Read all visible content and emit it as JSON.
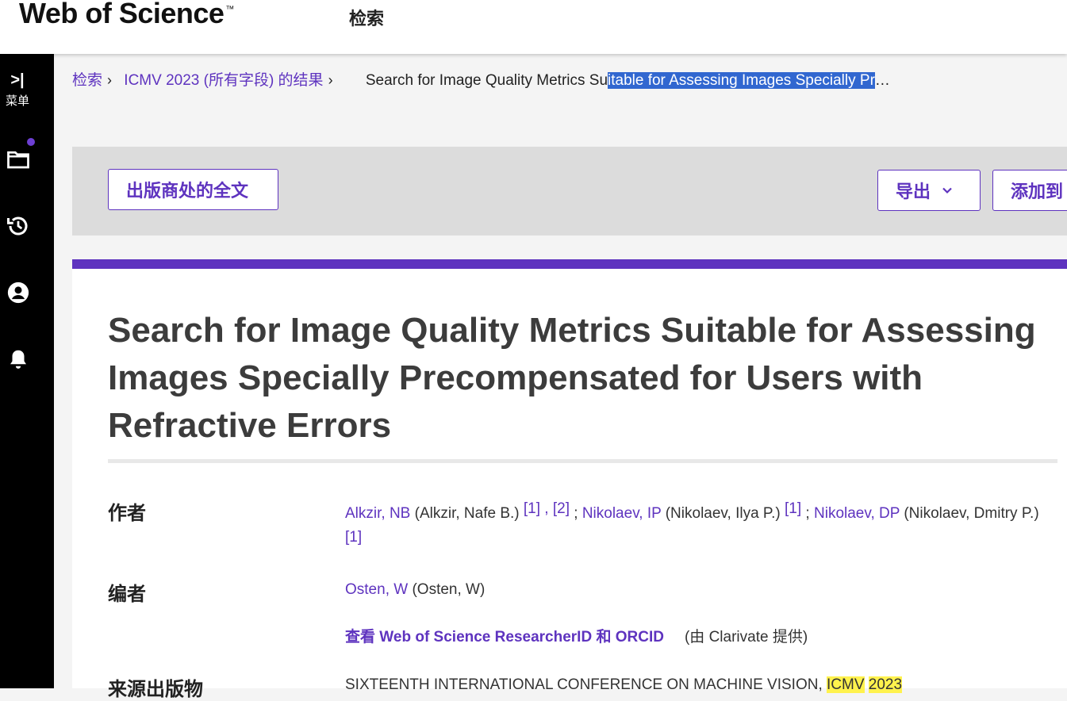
{
  "header": {
    "logo": "Web of Science",
    "logo_tm": "™",
    "nav_search": "检索"
  },
  "sidebar": {
    "menu_chevron": ">|",
    "menu_label": "菜单",
    "icons": [
      "folder-icon",
      "history-icon",
      "user-icon",
      "bell-icon"
    ]
  },
  "breadcrumb": {
    "search": "检索",
    "results": "ICMV 2023 (所有字段) 的结果",
    "current_plain": "Search for Image Quality Metrics Su",
    "current_selected": "itable for Assessing Images Specially Pr",
    "ellipsis": "…"
  },
  "toolbar": {
    "fulltext_label": "出版商处的全文",
    "export_label": "导出",
    "add_label": "添加到"
  },
  "record": {
    "title": "Search for Image Quality Metrics Suitable for Assessing Images Specially Precompensated for Users with Refractive Errors",
    "authors_label": "作者",
    "authors": {
      "a1_link": "Alkzir, NB",
      "a1_full": " (Alkzir, Nafe B.) ",
      "a1_ref1": "[1]",
      "a1_ref2": " , [2]",
      "sep1": " ; ",
      "a2_link": "Nikolaev, IP",
      "a2_full": " (Nikolaev, Ilya P.) ",
      "a2_ref": "[1]",
      "sep2": " ; ",
      "a3_link": "Nikolaev, DP",
      "a3_full": " (Nikolaev, Dmitry P.)",
      "a3_ref": "[1]"
    },
    "editors_label": "编者",
    "editor_link": "Osten, W",
    "editor_full": " (Osten, W)",
    "researcherid_prefix": "查看",
    "researcherid_mid": " Web of Science ResearcherID ",
    "researcherid_and": "和",
    "researcherid_suffix": " ORCID",
    "researcherid_provided": "(由 Clarivate 提供)",
    "source_label": "来源出版物",
    "source_text": "SIXTEENTH INTERNATIONAL CONFERENCE ON MACHINE VISION, ",
    "source_hl1": "ICMV",
    "source_hl2": "2023"
  },
  "colors": {
    "accent": "#5e33bf",
    "selection": "#3167d0",
    "highlight": "#fff24d"
  }
}
